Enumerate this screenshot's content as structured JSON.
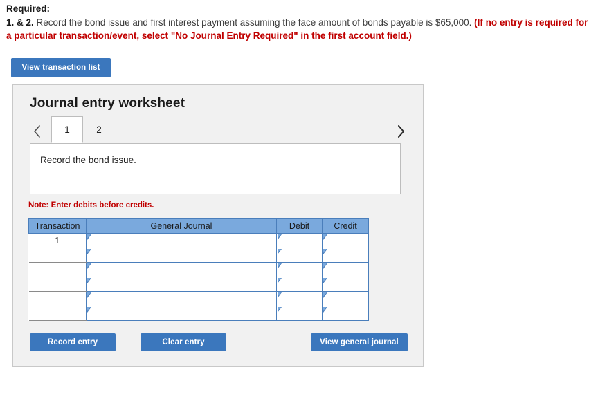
{
  "requirement": {
    "title": "Required:",
    "number": "1. & 2.",
    "text": " Record the bond issue and first interest payment assuming the face amount of bonds payable is $65,000. ",
    "red_note": "(If no entry is required for a particular transaction/event, select \"No Journal Entry Required\" in the first account field.)"
  },
  "toolbar": {
    "view_transaction_list": "View transaction list"
  },
  "panel": {
    "title": "Journal entry worksheet",
    "tabs": [
      {
        "label": "1",
        "active": true
      },
      {
        "label": "2",
        "active": false
      }
    ],
    "nav": {
      "prev_icon": "chevron-left-icon",
      "next_icon": "chevron-right-icon"
    },
    "description": "Record the bond issue.",
    "note": "Note: Enter debits before credits.",
    "table": {
      "headers": [
        "Transaction",
        "General Journal",
        "Debit",
        "Credit"
      ],
      "rows": [
        {
          "transaction": "1",
          "general_journal": "",
          "debit": "",
          "credit": ""
        },
        {
          "transaction": "",
          "general_journal": "",
          "debit": "",
          "credit": ""
        },
        {
          "transaction": "",
          "general_journal": "",
          "debit": "",
          "credit": ""
        },
        {
          "transaction": "",
          "general_journal": "",
          "debit": "",
          "credit": ""
        },
        {
          "transaction": "",
          "general_journal": "",
          "debit": "",
          "credit": ""
        },
        {
          "transaction": "",
          "general_journal": "",
          "debit": "",
          "credit": ""
        }
      ]
    },
    "buttons": {
      "record_entry": "Record entry",
      "clear_entry": "Clear entry",
      "view_general_journal": "View general journal"
    }
  },
  "colors": {
    "button_blue": "#3b77bd",
    "table_header_blue": "#7aa9dd",
    "cell_border_blue": "#4a7ebb",
    "alert_red": "#c00000",
    "panel_bg": "#f1f1f1"
  }
}
